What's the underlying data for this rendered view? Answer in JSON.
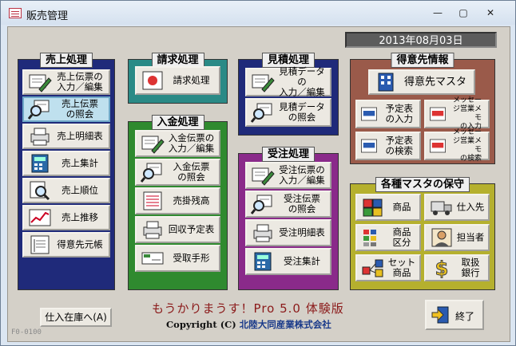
{
  "window": {
    "title": "販売管理",
    "minimize": "—",
    "restore": "▢",
    "close": "✕"
  },
  "date": "2013年08月03日",
  "sales": {
    "title": "売上処理",
    "buttons": [
      {
        "label": "売上伝票の\n入力／編集"
      },
      {
        "label": "売上伝票\nの照会"
      },
      {
        "label": "売上明細表"
      },
      {
        "label": "売上集計"
      },
      {
        "label": "売上順位"
      },
      {
        "label": "売上推移"
      },
      {
        "label": "得意先元帳"
      }
    ]
  },
  "billing": {
    "title": "請求処理",
    "buttons": [
      {
        "label": "請求処理"
      }
    ]
  },
  "payment": {
    "title": "入金処理",
    "buttons": [
      {
        "label": "入金伝票の\n入力／編集"
      },
      {
        "label": "入金伝票\nの照会"
      },
      {
        "label": "売掛残高"
      },
      {
        "label": "回収予定表"
      },
      {
        "label": "受取手形"
      }
    ]
  },
  "estimate": {
    "title": "見積処理",
    "buttons": [
      {
        "label": "見積データの\n入力／編集"
      },
      {
        "label": "見積データ\nの照会"
      }
    ]
  },
  "order": {
    "title": "受注処理",
    "buttons": [
      {
        "label": "受注伝票の\n入力／編集"
      },
      {
        "label": "受注伝票\nの照会"
      },
      {
        "label": "受注明細表"
      },
      {
        "label": "受注集計"
      }
    ]
  },
  "customer": {
    "title": "得意先情報",
    "master": "得意先マスタ",
    "buttons": [
      {
        "label": "予定表\nの入力"
      },
      {
        "label": "メッセージ営業メモ\nの入力"
      },
      {
        "label": "予定表\nの検索"
      },
      {
        "label": "メッセージ営業メモ\nの検索"
      }
    ]
  },
  "masters": {
    "title": "各種マスタの保守",
    "buttons": [
      {
        "label": "商品"
      },
      {
        "label": "仕入先"
      },
      {
        "label": "商品\n区分"
      },
      {
        "label": "担当者"
      },
      {
        "label": "セット\n商品"
      },
      {
        "label": "取扱\n銀行"
      }
    ]
  },
  "footer": {
    "inventory_button": "仕入在庫へ(A)",
    "trial": "もうかりまうす！Pro 5.0 体験版",
    "copyright": "Copyright (C)",
    "company": "北陸大同産業株式会社",
    "form_id": "F0-0100",
    "exit_button": "終了"
  },
  "colors": {
    "sales": "#1f2a7a",
    "estimate": "#1f2a7a",
    "billing": "#2a8a86",
    "payment": "#2f8a2f",
    "order": "#8a2a8a",
    "customer": "#9a5a4a",
    "masters": "#b5b02e"
  },
  "icons": {
    "sales": [
      "edit-slip-icon",
      "magnifier-slip-icon",
      "printer-icon",
      "calculator-icon",
      "search-icon",
      "trend-chart-icon",
      "ledger-icon"
    ],
    "payment": [
      "edit-slip-icon",
      "magnifier-slip-icon",
      "balance-list-icon",
      "printer-icon",
      "bill-icon"
    ],
    "estimate": [
      "edit-slip-icon",
      "magnifier-slip-icon"
    ],
    "order": [
      "edit-slip-icon",
      "magnifier-slip-icon",
      "printer-icon",
      "calculator-icon"
    ],
    "masters": [
      "product-icon",
      "supplier-truck-icon",
      "category-icon",
      "staff-icon",
      "set-product-icon",
      "bank-icon"
    ]
  }
}
